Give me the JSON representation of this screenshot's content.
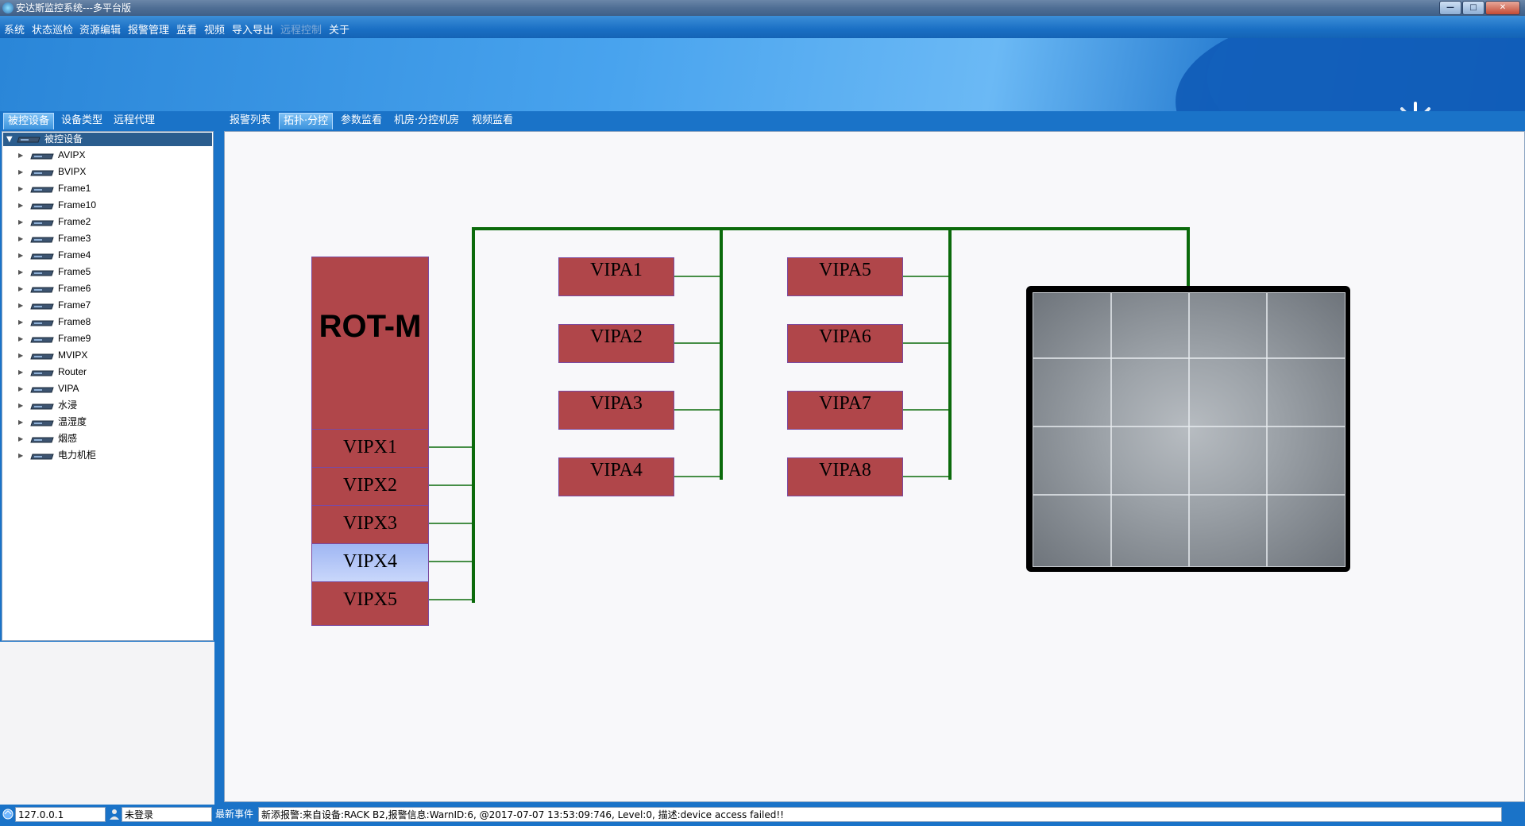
{
  "window": {
    "title": "安达斯监控系统---多平台版",
    "buttons": [
      "—",
      "□",
      "✕"
    ]
  },
  "menu": [
    {
      "label": "系统",
      "enabled": true
    },
    {
      "label": "状态巡检",
      "enabled": true
    },
    {
      "label": "资源编辑",
      "enabled": true
    },
    {
      "label": "报警管理",
      "enabled": true
    },
    {
      "label": "监看",
      "enabled": true
    },
    {
      "label": "视频",
      "enabled": true
    },
    {
      "label": "导入导出",
      "enabled": true
    },
    {
      "label": "远程控制",
      "enabled": false
    },
    {
      "label": "关于",
      "enabled": true
    }
  ],
  "left_tabs": [
    "被控设备",
    "设备类型",
    "远程代理"
  ],
  "left_tab_active": "被控设备",
  "right_tabs": [
    "报警列表",
    "拓扑·分控",
    "参数监看",
    "机房·分控机房",
    "视频监看"
  ],
  "right_tab_active": "拓扑·分控",
  "tree": {
    "root": "被控设备",
    "items": [
      "AVIPX",
      "BVIPX",
      "Frame1",
      "Frame10",
      "Frame2",
      "Frame3",
      "Frame4",
      "Frame5",
      "Frame6",
      "Frame7",
      "Frame8",
      "Frame9",
      "MVIPX",
      "Router",
      "VIPA",
      "水浸",
      "温湿度",
      "烟感",
      "电力机柜"
    ]
  },
  "topology": {
    "router": {
      "label": "ROT-M",
      "ports": [
        "VIPX1",
        "VIPX2",
        "VIPX3",
        "VIPX4",
        "VIPX5"
      ],
      "selected_port": "VIPX4"
    },
    "vipa_column_1": [
      "VIPA1",
      "VIPA2",
      "VIPA3",
      "VIPA4"
    ],
    "vipa_column_2": [
      "VIPA5",
      "VIPA6",
      "VIPA7",
      "VIPA8"
    ],
    "video_wall": {
      "rows": 4,
      "cols": 4
    },
    "colors": {
      "device": "#b0464a",
      "device_border": "#7b4aa0",
      "link": "#0b6a0b",
      "selected": "#a9bff5"
    }
  },
  "status": {
    "ip": "127.0.0.1",
    "user": "未登录",
    "event_label": "最新事件",
    "event_text": "新添报警:来自设备:RACK B2,报警信息:WarnID:6, @2017-07-07 13:53:09:746, Level:0, 描述:device access failed!!"
  }
}
